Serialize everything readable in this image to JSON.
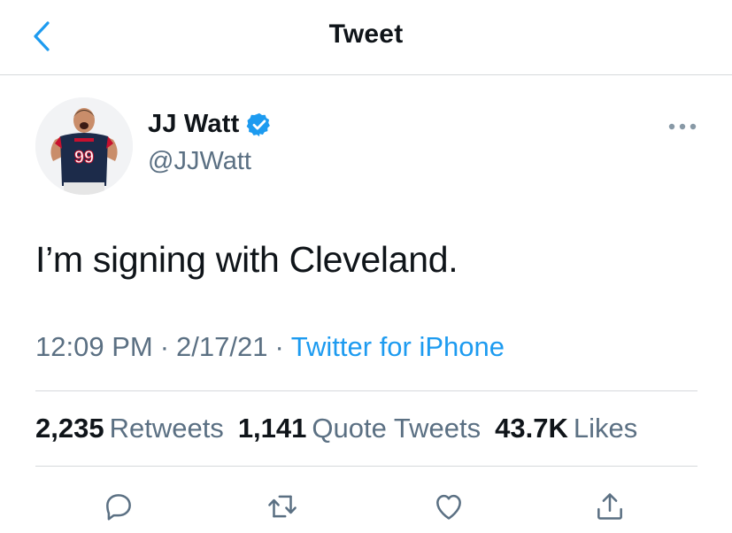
{
  "header": {
    "title": "Tweet"
  },
  "author": {
    "name": "JJ Watt",
    "handle": "@JJWatt",
    "jersey_number": "99",
    "verified": true
  },
  "tweet": {
    "text": "I’m signing with Cleveland.",
    "time": "12:09 PM",
    "date": "2/17/21",
    "separator": "·",
    "source": "Twitter for iPhone"
  },
  "stats": {
    "retweets": {
      "count": "2,235",
      "label": "Retweets"
    },
    "quotes": {
      "count": "1,141",
      "label": "Quote Tweets"
    },
    "likes": {
      "count": "43.7K",
      "label": "Likes"
    }
  },
  "actions": [
    "reply-icon",
    "retweet-icon",
    "like-icon",
    "share-icon"
  ],
  "colors": {
    "accent": "#1d9bf0",
    "secondary_text": "#5b7083",
    "divider": "#d6d9dc",
    "jersey": "#1c2b4a",
    "jersey_red": "#c8102e"
  }
}
